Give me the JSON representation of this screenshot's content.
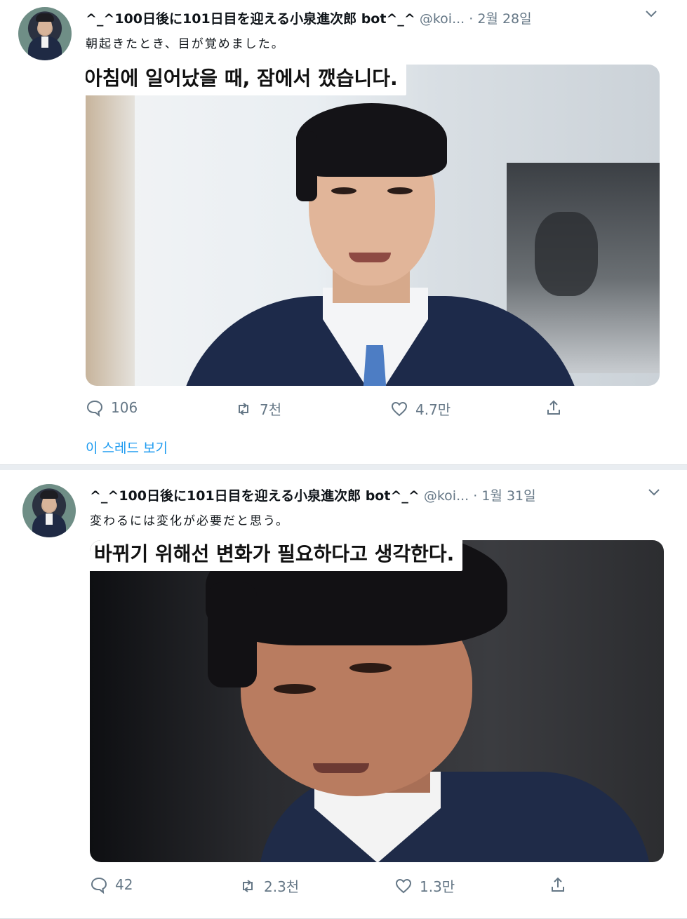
{
  "tweets": [
    {
      "display_name": "^_^100日後に101日目を迎える小泉進次郎 bot^_^",
      "handle": "@koi...",
      "date": "2월 28일",
      "text": "朝起きたとき、目が覚めました。",
      "caption": "아침에 일어났을 때, 잠에서 깼습니다.",
      "replies": "106",
      "retweets": "7천",
      "likes": "4.7만",
      "thread_link": "이 스레드 보기"
    },
    {
      "display_name": "^_^100日後に101日目を迎える小泉進次郎 bot^_^",
      "handle": "@koi...",
      "date": "1월 31일",
      "text": "変わるには変化が必要だと思う。",
      "caption": "바뀌기 위해선 변화가 필요하다고 생각한다.",
      "replies": "42",
      "retweets": "2.3천",
      "likes": "1.3만"
    }
  ],
  "icons": {
    "reply": "speech-bubble-icon",
    "retweet": "retweet-icon",
    "like": "heart-icon",
    "share": "share-icon",
    "more": "chevron-down-icon"
  },
  "colors": {
    "secondary_text": "#657786",
    "link": "#1d9bf0"
  }
}
